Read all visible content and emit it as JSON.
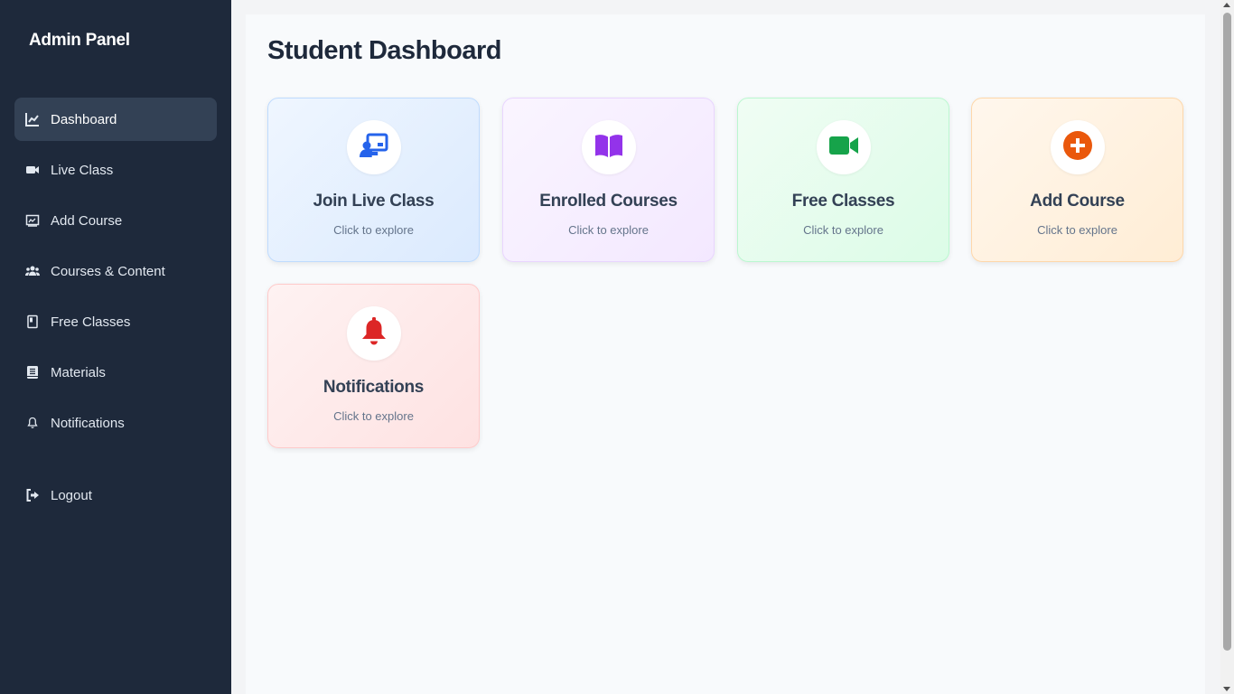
{
  "sidebar": {
    "brand": "Admin Panel",
    "items": [
      {
        "label": "Dashboard",
        "icon": "chart-line-icon",
        "active": true
      },
      {
        "label": "Live Class",
        "icon": "video-icon"
      },
      {
        "label": "Add Course",
        "icon": "chalkboard-icon"
      },
      {
        "label": "Courses & Content",
        "icon": "users-icon"
      },
      {
        "label": "Free Classes",
        "icon": "book-icon"
      },
      {
        "label": "Materials",
        "icon": "book-closed-icon"
      },
      {
        "label": "Notifications",
        "icon": "bell-icon"
      }
    ],
    "logout": {
      "label": "Logout",
      "icon": "sign-out-icon"
    }
  },
  "main": {
    "title": "Student Dashboard",
    "cards": [
      {
        "title": "Join Live Class",
        "subtitle": "Click to explore",
        "icon": "chalkboard-teacher-icon",
        "color": "#2563eb"
      },
      {
        "title": "Enrolled Courses",
        "subtitle": "Click to explore",
        "icon": "book-open-icon",
        "color": "#9333ea"
      },
      {
        "title": "Free Classes",
        "subtitle": "Click to explore",
        "icon": "video-icon",
        "color": "#16a34a"
      },
      {
        "title": "Add Course",
        "subtitle": "Click to explore",
        "icon": "plus-circle-icon",
        "color": "#ea580c"
      },
      {
        "title": "Notifications",
        "subtitle": "Click to explore",
        "icon": "bell-icon",
        "color": "#dc2626"
      }
    ]
  },
  "colors": {
    "sidebar_bg": "#1e293b",
    "active_item_bg": "#334155",
    "main_bg": "#f8fafc"
  }
}
